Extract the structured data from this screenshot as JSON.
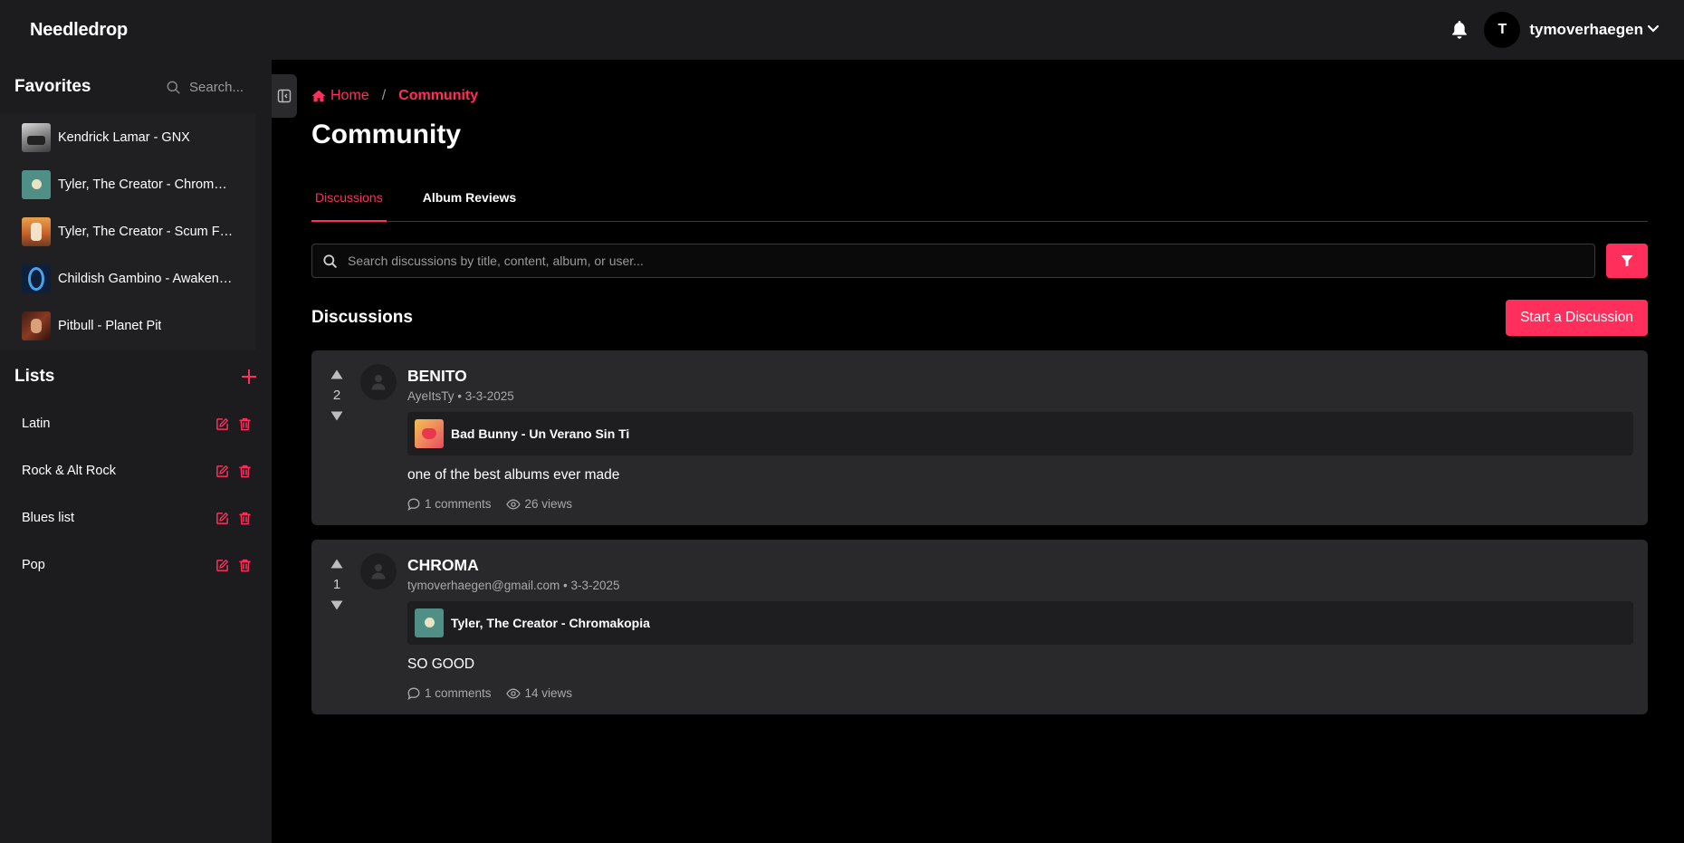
{
  "app": {
    "brand": "Needledrop"
  },
  "user": {
    "initial": "T",
    "name": "tymoverhaegen"
  },
  "colors": {
    "accent": "#ff2e5b",
    "sidebar_bg": "#1c1c1e",
    "card_bg": "#29292b"
  },
  "sidebar": {
    "favorites_title": "Favorites",
    "search_placeholder": "Search...",
    "favorites": [
      {
        "label": "Kendrick Lamar - GNX"
      },
      {
        "label": "Tyler, The Creator - Chromakopia"
      },
      {
        "label": "Tyler, The Creator - Scum Fuck ..."
      },
      {
        "label": "Childish Gambino - Awaken, M..."
      },
      {
        "label": "Pitbull - Planet Pit"
      }
    ],
    "lists_title": "Lists",
    "lists": [
      {
        "label": "Latin"
      },
      {
        "label": "Rock & Alt Rock"
      },
      {
        "label": "Blues list"
      },
      {
        "label": "Pop"
      }
    ]
  },
  "main": {
    "breadcrumb": {
      "home": "Home",
      "separator": "/",
      "current": "Community"
    },
    "title": "Community",
    "tabs": [
      {
        "label": "Discussions",
        "active": true
      },
      {
        "label": "Album Reviews",
        "active": false
      }
    ],
    "search_placeholder": "Search discussions by title, content, album, or user...",
    "discussions_title": "Discussions",
    "start_button": "Start a Discussion",
    "posts": [
      {
        "votes": "2",
        "title": "BENITO",
        "meta": "AyeItsTy • 3-3-2025",
        "album": "Bad Bunny - Un Verano Sin Ti",
        "text": "one of the best albums ever made",
        "comments": "1 comments",
        "views": "26 views"
      },
      {
        "votes": "1",
        "title": "CHROMA",
        "meta": "tymoverhaegen@gmail.com • 3-3-2025",
        "album": "Tyler, The Creator - Chromakopia",
        "text": "SO GOOD",
        "comments": "1 comments",
        "views": "14 views"
      }
    ]
  }
}
